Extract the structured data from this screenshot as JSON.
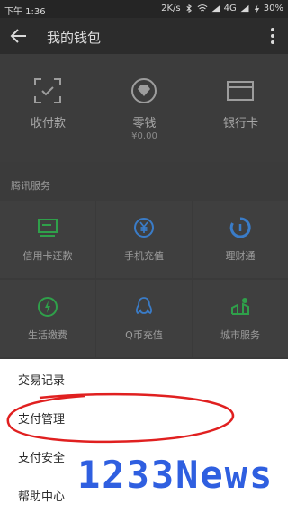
{
  "status_bar": {
    "time": "下午 1:36",
    "net_speed": "2K/s",
    "network": "4G",
    "battery": "30%"
  },
  "header": {
    "title": "我的钱包",
    "back_icon": "back-arrow-icon",
    "more_icon": "more-vertical-icon"
  },
  "wallet": {
    "items": [
      {
        "label": "收付款",
        "icon": "scan-pay-icon"
      },
      {
        "label": "零钱",
        "sub": "¥0.00",
        "icon": "change-diamond-icon"
      },
      {
        "label": "银行卡",
        "icon": "bank-card-icon"
      }
    ]
  },
  "tencent_services": {
    "title": "腾讯服务",
    "items": [
      {
        "label": "信用卡还款",
        "icon": "credit-card-repay-icon",
        "color": "#2fa04a"
      },
      {
        "label": "手机充值",
        "icon": "yen-phone-recharge-icon",
        "color": "#3a7cc8"
      },
      {
        "label": "理财通",
        "icon": "wealth-icon",
        "color": "#3a7cc8"
      },
      {
        "label": "生活缴费",
        "icon": "utility-bill-icon",
        "color": "#2fa04a"
      },
      {
        "label": "Q币充值",
        "icon": "qq-penguin-icon",
        "color": "#3a7cc8"
      },
      {
        "label": "城市服务",
        "icon": "city-service-icon",
        "color": "#2fa04a"
      }
    ]
  },
  "menu": {
    "items": [
      {
        "label": "交易记录"
      },
      {
        "label": "支付管理"
      },
      {
        "label": "支付安全"
      },
      {
        "label": "帮助中心"
      }
    ]
  },
  "watermark": "1233News",
  "colors": {
    "highlight": "#e02020",
    "watermark": "#2f5fe0"
  }
}
